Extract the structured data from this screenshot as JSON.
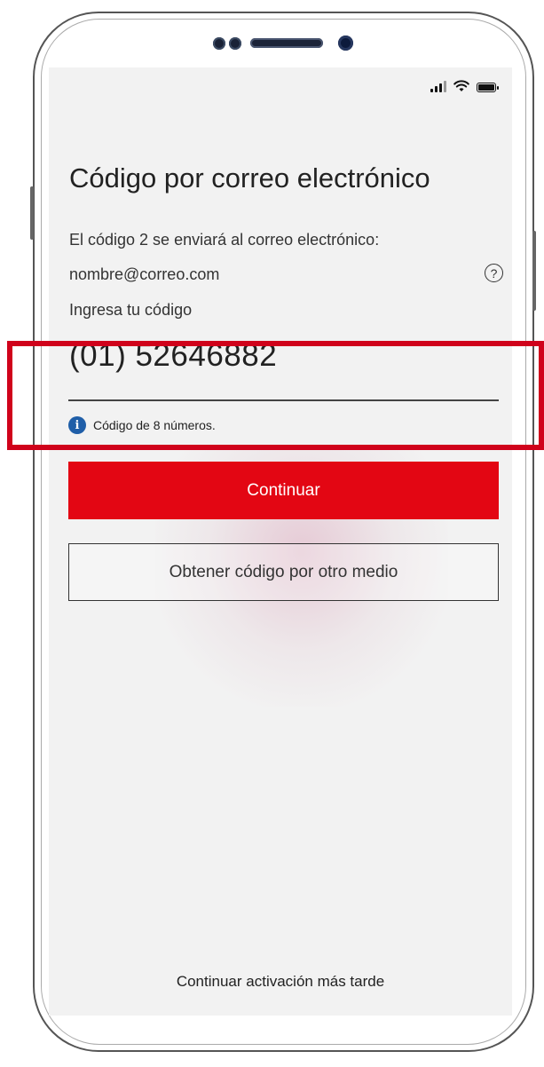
{
  "screen": {
    "title": "Código por correo electrónico",
    "send_notice": "El código 2 se enviará al correo electrónico:",
    "email": "nombre@correo.com",
    "help_glyph": "?",
    "code_label": "Ingresa tu código",
    "code_value": "(01) 52646882",
    "hint_icon": "i",
    "hint_text": "Código de 8 números.",
    "continue_label": "Continuar",
    "other_method_label": "Obtener código por otro medio",
    "later_label": "Continuar activación más tarde"
  },
  "colors": {
    "accent": "#e30613",
    "highlight": "#d0021b",
    "info": "#1f5ea8",
    "background": "#f2f2f2"
  }
}
